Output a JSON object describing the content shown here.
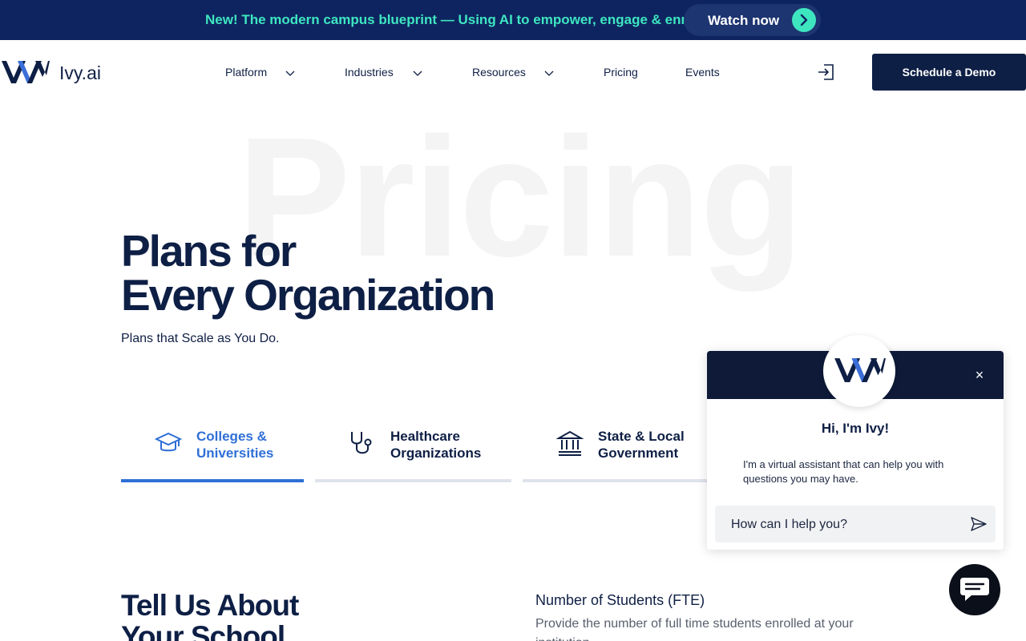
{
  "announcement": {
    "text": "New! The modern campus blueprint — Using AI to empower, engage & enroll",
    "cta_label": "Watch now"
  },
  "header": {
    "logo_text": "Ivy.ai",
    "nav": [
      {
        "label": "Platform",
        "has_dropdown": true
      },
      {
        "label": "Industries",
        "has_dropdown": true
      },
      {
        "label": "Resources",
        "has_dropdown": true
      },
      {
        "label": "Pricing",
        "has_dropdown": false
      },
      {
        "label": "Events",
        "has_dropdown": false
      }
    ],
    "login_icon": "login-icon",
    "demo_label": "Schedule a  Demo"
  },
  "hero": {
    "watermark": "Pricing",
    "title_line1": "Plans for",
    "title_line2": "Every Organization",
    "subtitle": "Plans that Scale as You Do."
  },
  "tabs": [
    {
      "line1": "Colleges &",
      "line2": "Universities",
      "icon": "graduation-cap-icon",
      "active": true
    },
    {
      "line1": "Healthcare",
      "line2": "Organizations",
      "icon": "stethoscope-icon",
      "active": false
    },
    {
      "line1": "State & Local",
      "line2": "Government",
      "icon": "government-building-icon",
      "active": false
    }
  ],
  "tell_us": {
    "title_line1": "Tell Us About",
    "title_line2": "Your School",
    "students_label": "Number of Students (FTE)",
    "students_help": "Provide the number of full time students enrolled at your institution."
  },
  "chat": {
    "greeting": "Hi, I'm Ivy!",
    "message": "I'm a virtual assistant that can help you with questions you may have.",
    "input_placeholder": "How can I help you?",
    "close_label": "×"
  },
  "colors": {
    "navy": "#0e1f45",
    "announce_bg": "#0e2460",
    "accent_teal": "#3ee6c0",
    "active_blue": "#2f6fd6"
  }
}
